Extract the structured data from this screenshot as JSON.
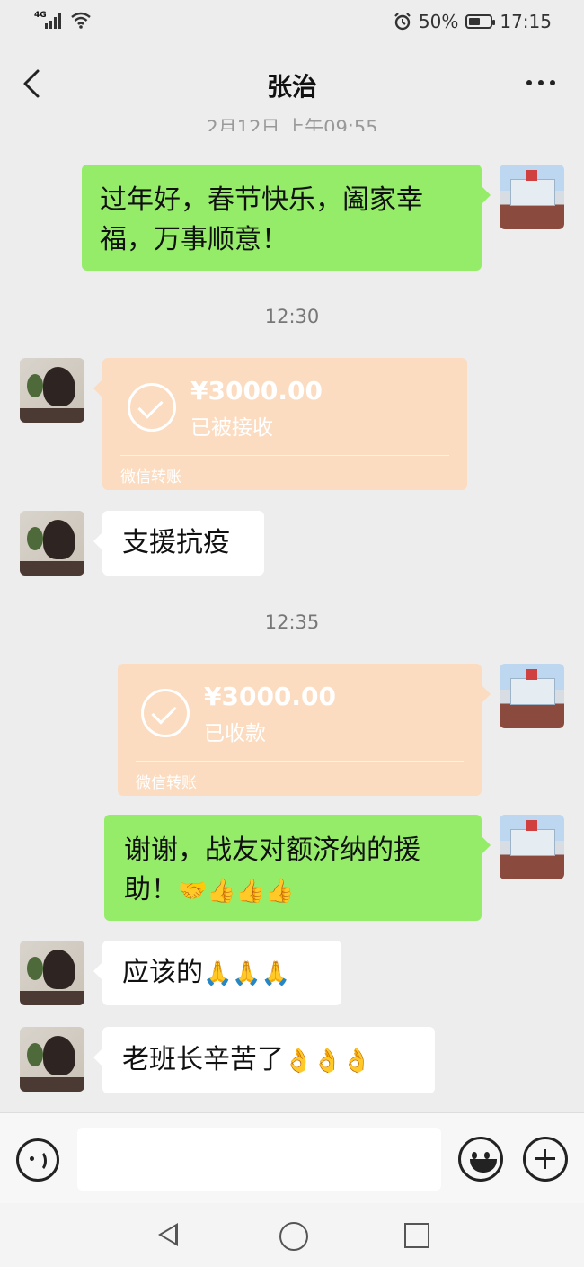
{
  "status_bar": {
    "network": "4G",
    "battery": "50%",
    "battery_level": 0.5,
    "time": "17:15"
  },
  "header": {
    "title": "张治"
  },
  "messages": {
    "ts0": "2月12日 上午09:55",
    "m1_text": "过年好，春节快乐，阖家幸福，万事顺意！",
    "ts1": "12:30",
    "m2_amount": "¥3000.00",
    "m2_status": "已被接收",
    "m2_label": "微信转账",
    "m3_text": "支援抗疫",
    "ts2": "12:35",
    "m4_amount": "¥3000.00",
    "m4_status": "已收款",
    "m4_label": "微信转账",
    "m5_text": "谢谢，战友对额济纳的援助！",
    "m5_emoji": "🤝👍👍👍",
    "m6_text": "应该的",
    "m6_emoji": "🙏🙏🙏",
    "m7_text": "老班长辛苦了",
    "m7_emoji": "👌👌👌"
  },
  "input": {
    "value": ""
  }
}
